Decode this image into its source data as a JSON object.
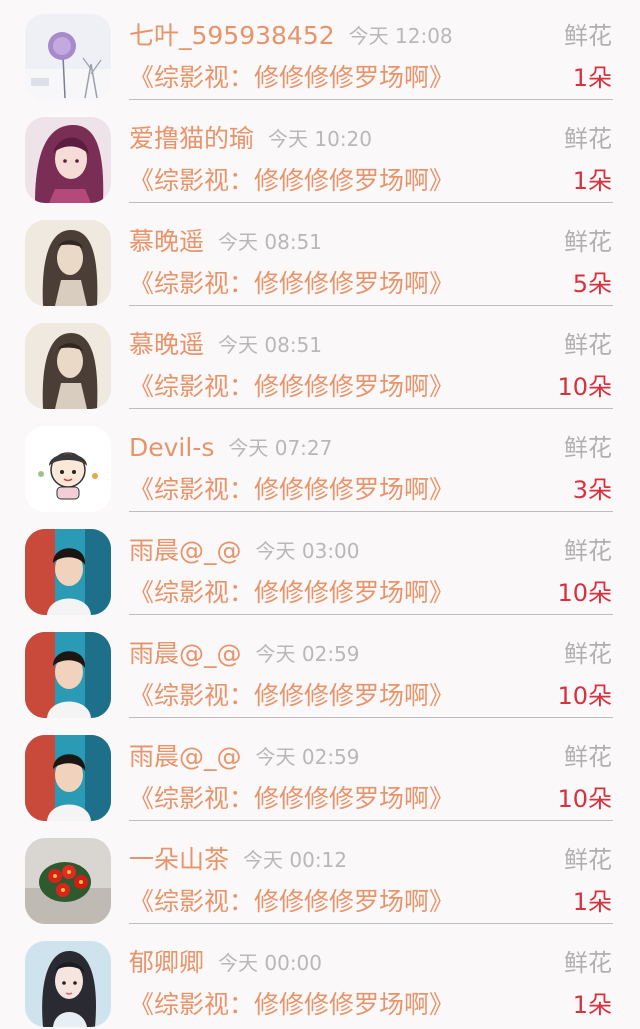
{
  "items": [
    {
      "name": "七叶_595938452",
      "time": "今天 12:08",
      "gift": "鲜花",
      "book": "《综影视：修修修修罗场啊》",
      "count": "1朵",
      "avatar": "dandelion-avatar"
    },
    {
      "name": "爱撸猫的瑜",
      "time": "今天 10:20",
      "gift": "鲜花",
      "book": "《综影视：修修修修罗场啊》",
      "count": "1朵",
      "avatar": "anime-girl-avatar"
    },
    {
      "name": "慕晚遥",
      "time": "今天 08:51",
      "gift": "鲜花",
      "book": "《综影视：修修修修罗场啊》",
      "count": "5朵",
      "avatar": "ink-figure-avatar"
    },
    {
      "name": "慕晚遥",
      "time": "今天 08:51",
      "gift": "鲜花",
      "book": "《综影视：修修修修罗场啊》",
      "count": "10朵",
      "avatar": "ink-figure-avatar"
    },
    {
      "name": "Devil-s",
      "time": "今天 07:27",
      "gift": "鲜花",
      "book": "《综影视：修修修修罗场啊》",
      "count": "3朵",
      "avatar": "cartoon-avatar"
    },
    {
      "name": "雨晨@_@",
      "time": "今天 03:00",
      "gift": "鲜花",
      "book": "《综影视：修修修修罗场啊》",
      "count": "10朵",
      "avatar": "photo-boy-avatar"
    },
    {
      "name": "雨晨@_@",
      "time": "今天 02:59",
      "gift": "鲜花",
      "book": "《综影视：修修修修罗场啊》",
      "count": "10朵",
      "avatar": "photo-boy-avatar"
    },
    {
      "name": "雨晨@_@",
      "time": "今天 02:59",
      "gift": "鲜花",
      "book": "《综影视：修修修修罗场啊》",
      "count": "10朵",
      "avatar": "photo-boy-avatar"
    },
    {
      "name": "一朵山茶",
      "time": "今天 00:12",
      "gift": "鲜花",
      "book": "《综影视：修修修修罗场啊》",
      "count": "1朵",
      "avatar": "red-camellia-avatar"
    },
    {
      "name": "郁卿卿",
      "time": "今天 00:00",
      "gift": "鲜花",
      "book": "《综影视：修修修修罗场啊》",
      "count": "1朵",
      "avatar": "portrait-girl-avatar"
    }
  ],
  "colors": {
    "name": "#e8946a",
    "time": "#b8b8b8",
    "gift": "#b0b0b0",
    "count": "#d8303d",
    "divider": "#bdbdbd",
    "background": "#fbf8f9"
  }
}
